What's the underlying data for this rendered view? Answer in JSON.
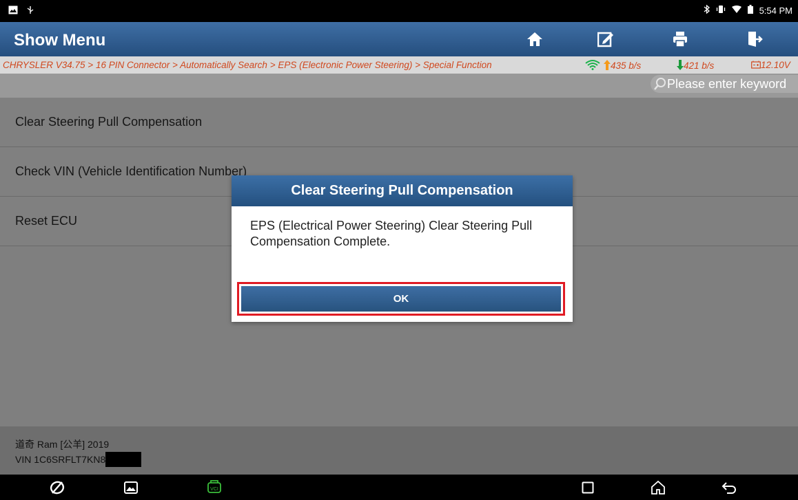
{
  "status_bar": {
    "time": "5:54 PM"
  },
  "header": {
    "title": "Show Menu"
  },
  "breadcrumb": {
    "path": "CHRYSLER V34.75 > 16 PIN Connector > Automatically Search > EPS (Electronic Power Steering) > Special Function",
    "upload_rate": "435 b/s",
    "download_rate": "421 b/s",
    "voltage": "12.10V"
  },
  "search": {
    "placeholder": "Please enter keyword"
  },
  "menu": {
    "items": [
      {
        "label": "Clear Steering Pull Compensation"
      },
      {
        "label": "Check VIN (Vehicle Identification Number)"
      },
      {
        "label": "Reset ECU"
      }
    ]
  },
  "vehicle": {
    "model": "道奇 Ram [公羊] 2019",
    "vin": "VIN 1C6SRFLT7KN8"
  },
  "dialog": {
    "title": "Clear Steering Pull Compensation",
    "message": "EPS (Electrical Power Steering) Clear Steering Pull Compensation Complete.",
    "ok_label": "OK"
  },
  "colors": {
    "accent": "#2e5b8c",
    "breadcrumb_text": "#d0481e",
    "highlight": "#e01b24"
  }
}
